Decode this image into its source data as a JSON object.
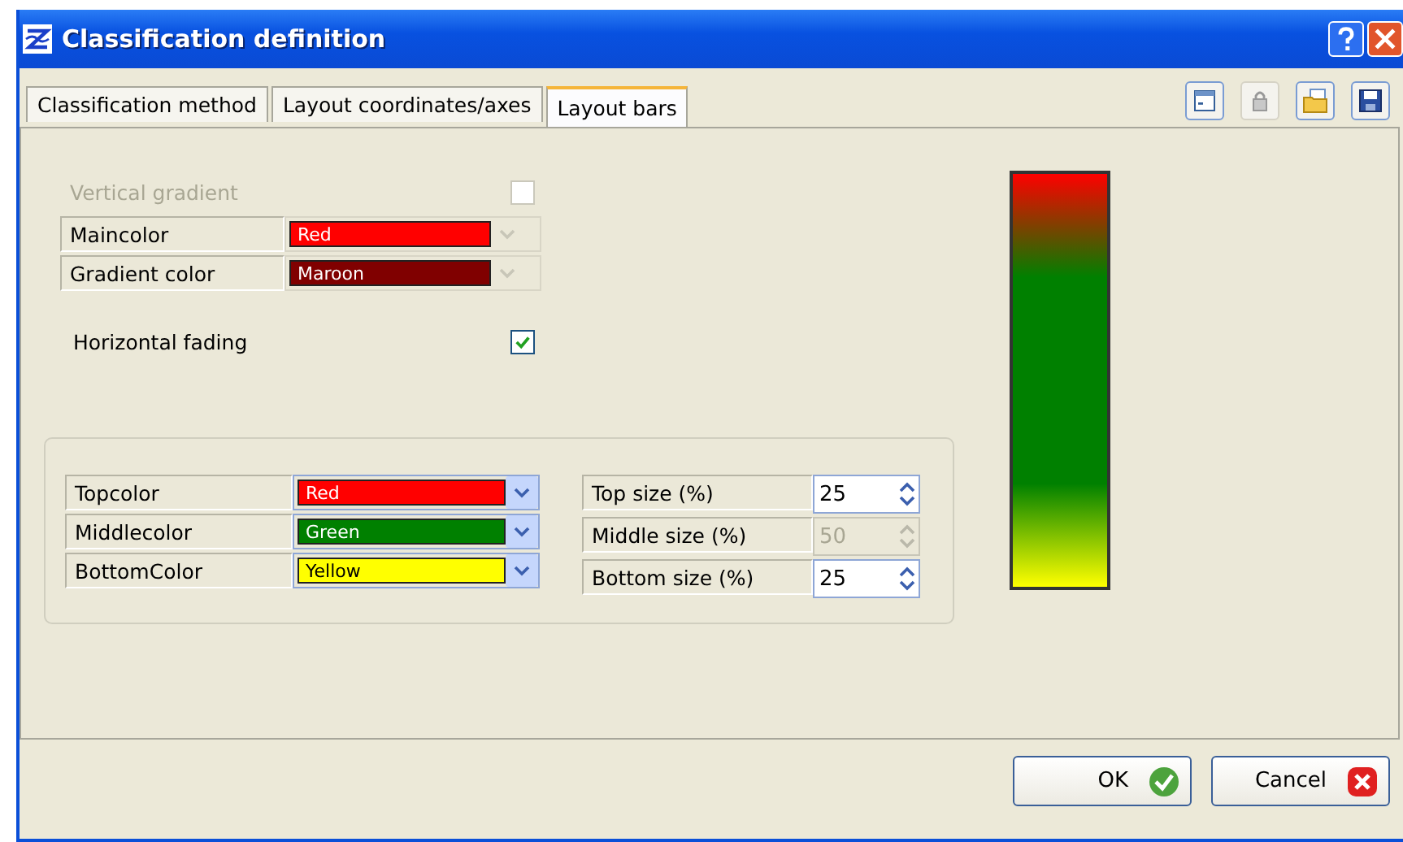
{
  "window": {
    "title": "Classification definition"
  },
  "tabs": [
    {
      "label": "Classification method",
      "selected": false
    },
    {
      "label": "Layout coordinates/axes",
      "selected": false
    },
    {
      "label": "Layout bars",
      "selected": true
    }
  ],
  "toolbar": [
    {
      "kind": "window",
      "disabled": false
    },
    {
      "kind": "lock",
      "disabled": true
    },
    {
      "kind": "folder",
      "disabled": false
    },
    {
      "kind": "save",
      "disabled": false
    }
  ],
  "vertical_gradient": {
    "label": "Vertical gradient",
    "checked": false,
    "disabled": true
  },
  "gradient_colors": [
    {
      "label": "Maincolor",
      "value": "Red",
      "color": "#ff0000",
      "disabled": true
    },
    {
      "label": "Gradient color",
      "value": "Maroon",
      "color": "#800000",
      "disabled": true
    }
  ],
  "horizontal_fading": {
    "label": "Horizontal fading",
    "checked": true,
    "disabled": false
  },
  "fading_colors": [
    {
      "label": "Topcolor",
      "value": "Red",
      "color": "#ff0000",
      "disabled": false
    },
    {
      "label": "Middlecolor",
      "value": "Green",
      "color": "#008000",
      "disabled": false
    },
    {
      "label": "BottomColor",
      "value": "Yellow",
      "color": "#ffff00",
      "disabled": false
    }
  ],
  "sizes": [
    {
      "label": "Top size (%)",
      "value": "25",
      "disabled": false
    },
    {
      "label": "Middle size (%)",
      "value": "50",
      "disabled": true
    },
    {
      "label": "Bottom size (%)",
      "value": "25",
      "disabled": false
    }
  ],
  "buttons": [
    {
      "label": "OK",
      "kind": "ok"
    },
    {
      "label": "Cancel",
      "kind": "cancel"
    }
  ]
}
